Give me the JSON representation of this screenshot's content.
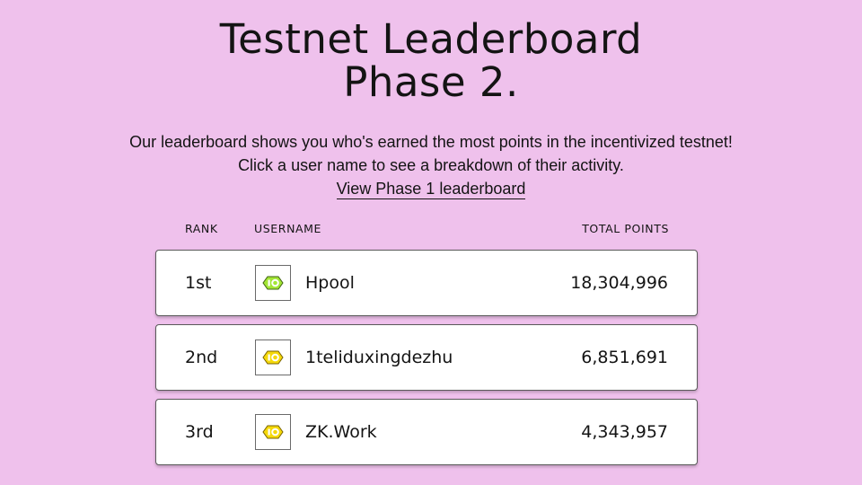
{
  "header": {
    "title_line1": "Testnet Leaderboard",
    "title_line2": "Phase 2."
  },
  "intro": {
    "text": "Our leaderboard shows you who's earned the most points in the incentivized testnet! Click a user name to see a breakdown of their activity.",
    "link_label": "View Phase 1 leaderboard"
  },
  "columns": {
    "rank": "RANK",
    "username": "USERNAME",
    "points": "TOTAL POINTS"
  },
  "rows": [
    {
      "rank": "1st",
      "username": "Hpool",
      "points": "18,304,996",
      "avatar_icon": "logo-badge-icon",
      "avatar_color": "#a3e635"
    },
    {
      "rank": "2nd",
      "username": "1teliduxingdezhu",
      "points": "6,851,691",
      "avatar_icon": "logo-badge-icon",
      "avatar_color": "#f5d90a"
    },
    {
      "rank": "3rd",
      "username": "ZK.Work",
      "points": "4,343,957",
      "avatar_icon": "logo-badge-icon",
      "avatar_color": "#f5d90a"
    }
  ],
  "colors": {
    "background": "#efc1ec",
    "card": "#ffffff",
    "text": "#141414"
  }
}
